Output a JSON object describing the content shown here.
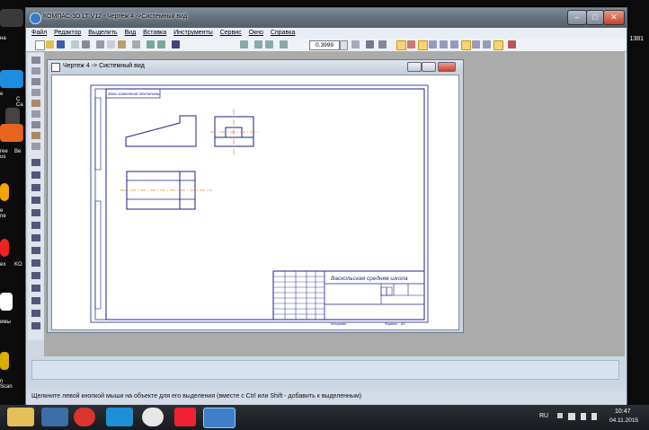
{
  "window": {
    "title": "КОМПАС-3D LT V12 - Чертеж 4 ->Системный вид",
    "minimize": "–",
    "maximize": "□",
    "close": "✕"
  },
  "menu": [
    "Файл",
    "Редактор",
    "Выделить",
    "Вид",
    "Вставка",
    "Инструменты",
    "Сервис",
    "Окно",
    "Справка"
  ],
  "toolbar": {
    "zoom_value": "0.3999"
  },
  "document": {
    "title": "Чертеж 4 -> Системный вид",
    "stamp_top": "Зоны изменений отключены",
    "title_block": {
      "organization": "Васкольская средняя школа",
      "sheet_label": "Копировал",
      "format_label": "Формат",
      "format_value": "A3"
    }
  },
  "status": {
    "hint": "Щелкните левой кнопкой мыши на объекте для его выделения (вместе с Ctrl или Shift - добавить к выделенным)"
  },
  "desktop": {
    "left_labels": [
      "на",
      "е",
      "C Ca",
      "ree us",
      "Be",
      "e ne",
      "ex",
      "KO",
      "имы",
      "n Scan"
    ],
    "right_label": "1381"
  },
  "tray": {
    "lang": "RU",
    "time": "10:47",
    "date": "04.11.2015"
  },
  "colors": {
    "drawing_line": "#1b1f8c",
    "axis_line": "#e08a2a",
    "title_bar": "#66737f"
  }
}
